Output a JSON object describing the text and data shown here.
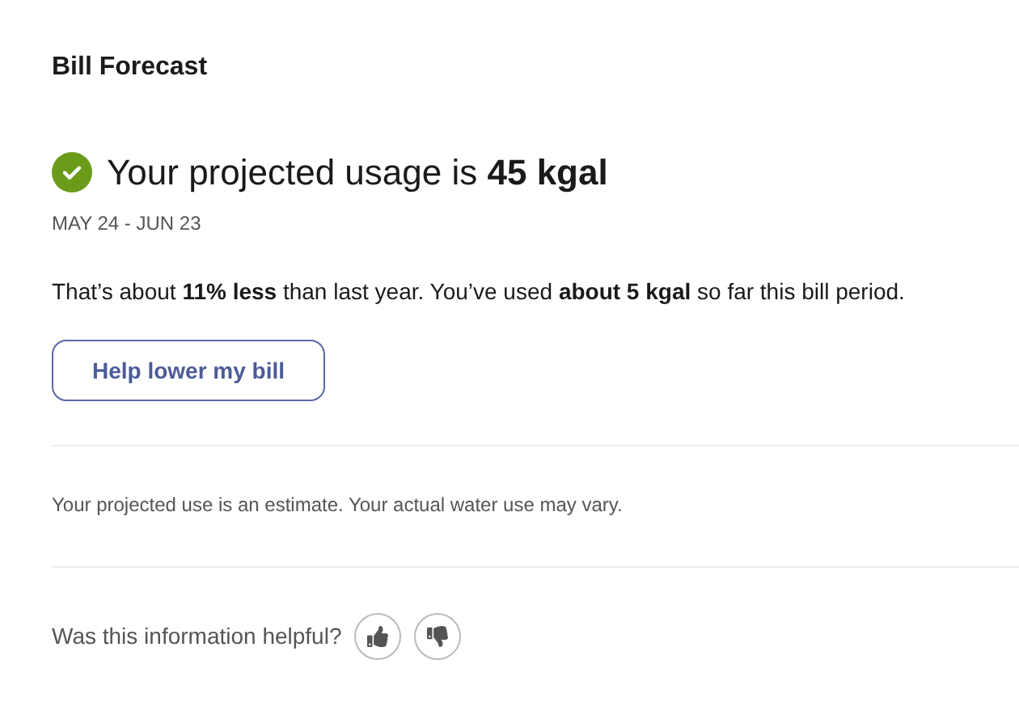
{
  "title": "Bill Forecast",
  "projection": {
    "headline": "Your projected usage is **45 kgal**",
    "period": "MAY 24 - JUN 23"
  },
  "summary": "That’s about **11% less** than last year. You’ve used **about 5 kgal** so far this bill period.",
  "action_button": "Help lower my bill",
  "disclaimer": "Your projected use is an estimate. Your actual water use may vary.",
  "feedback": {
    "question": "Was this information helpful?"
  }
}
